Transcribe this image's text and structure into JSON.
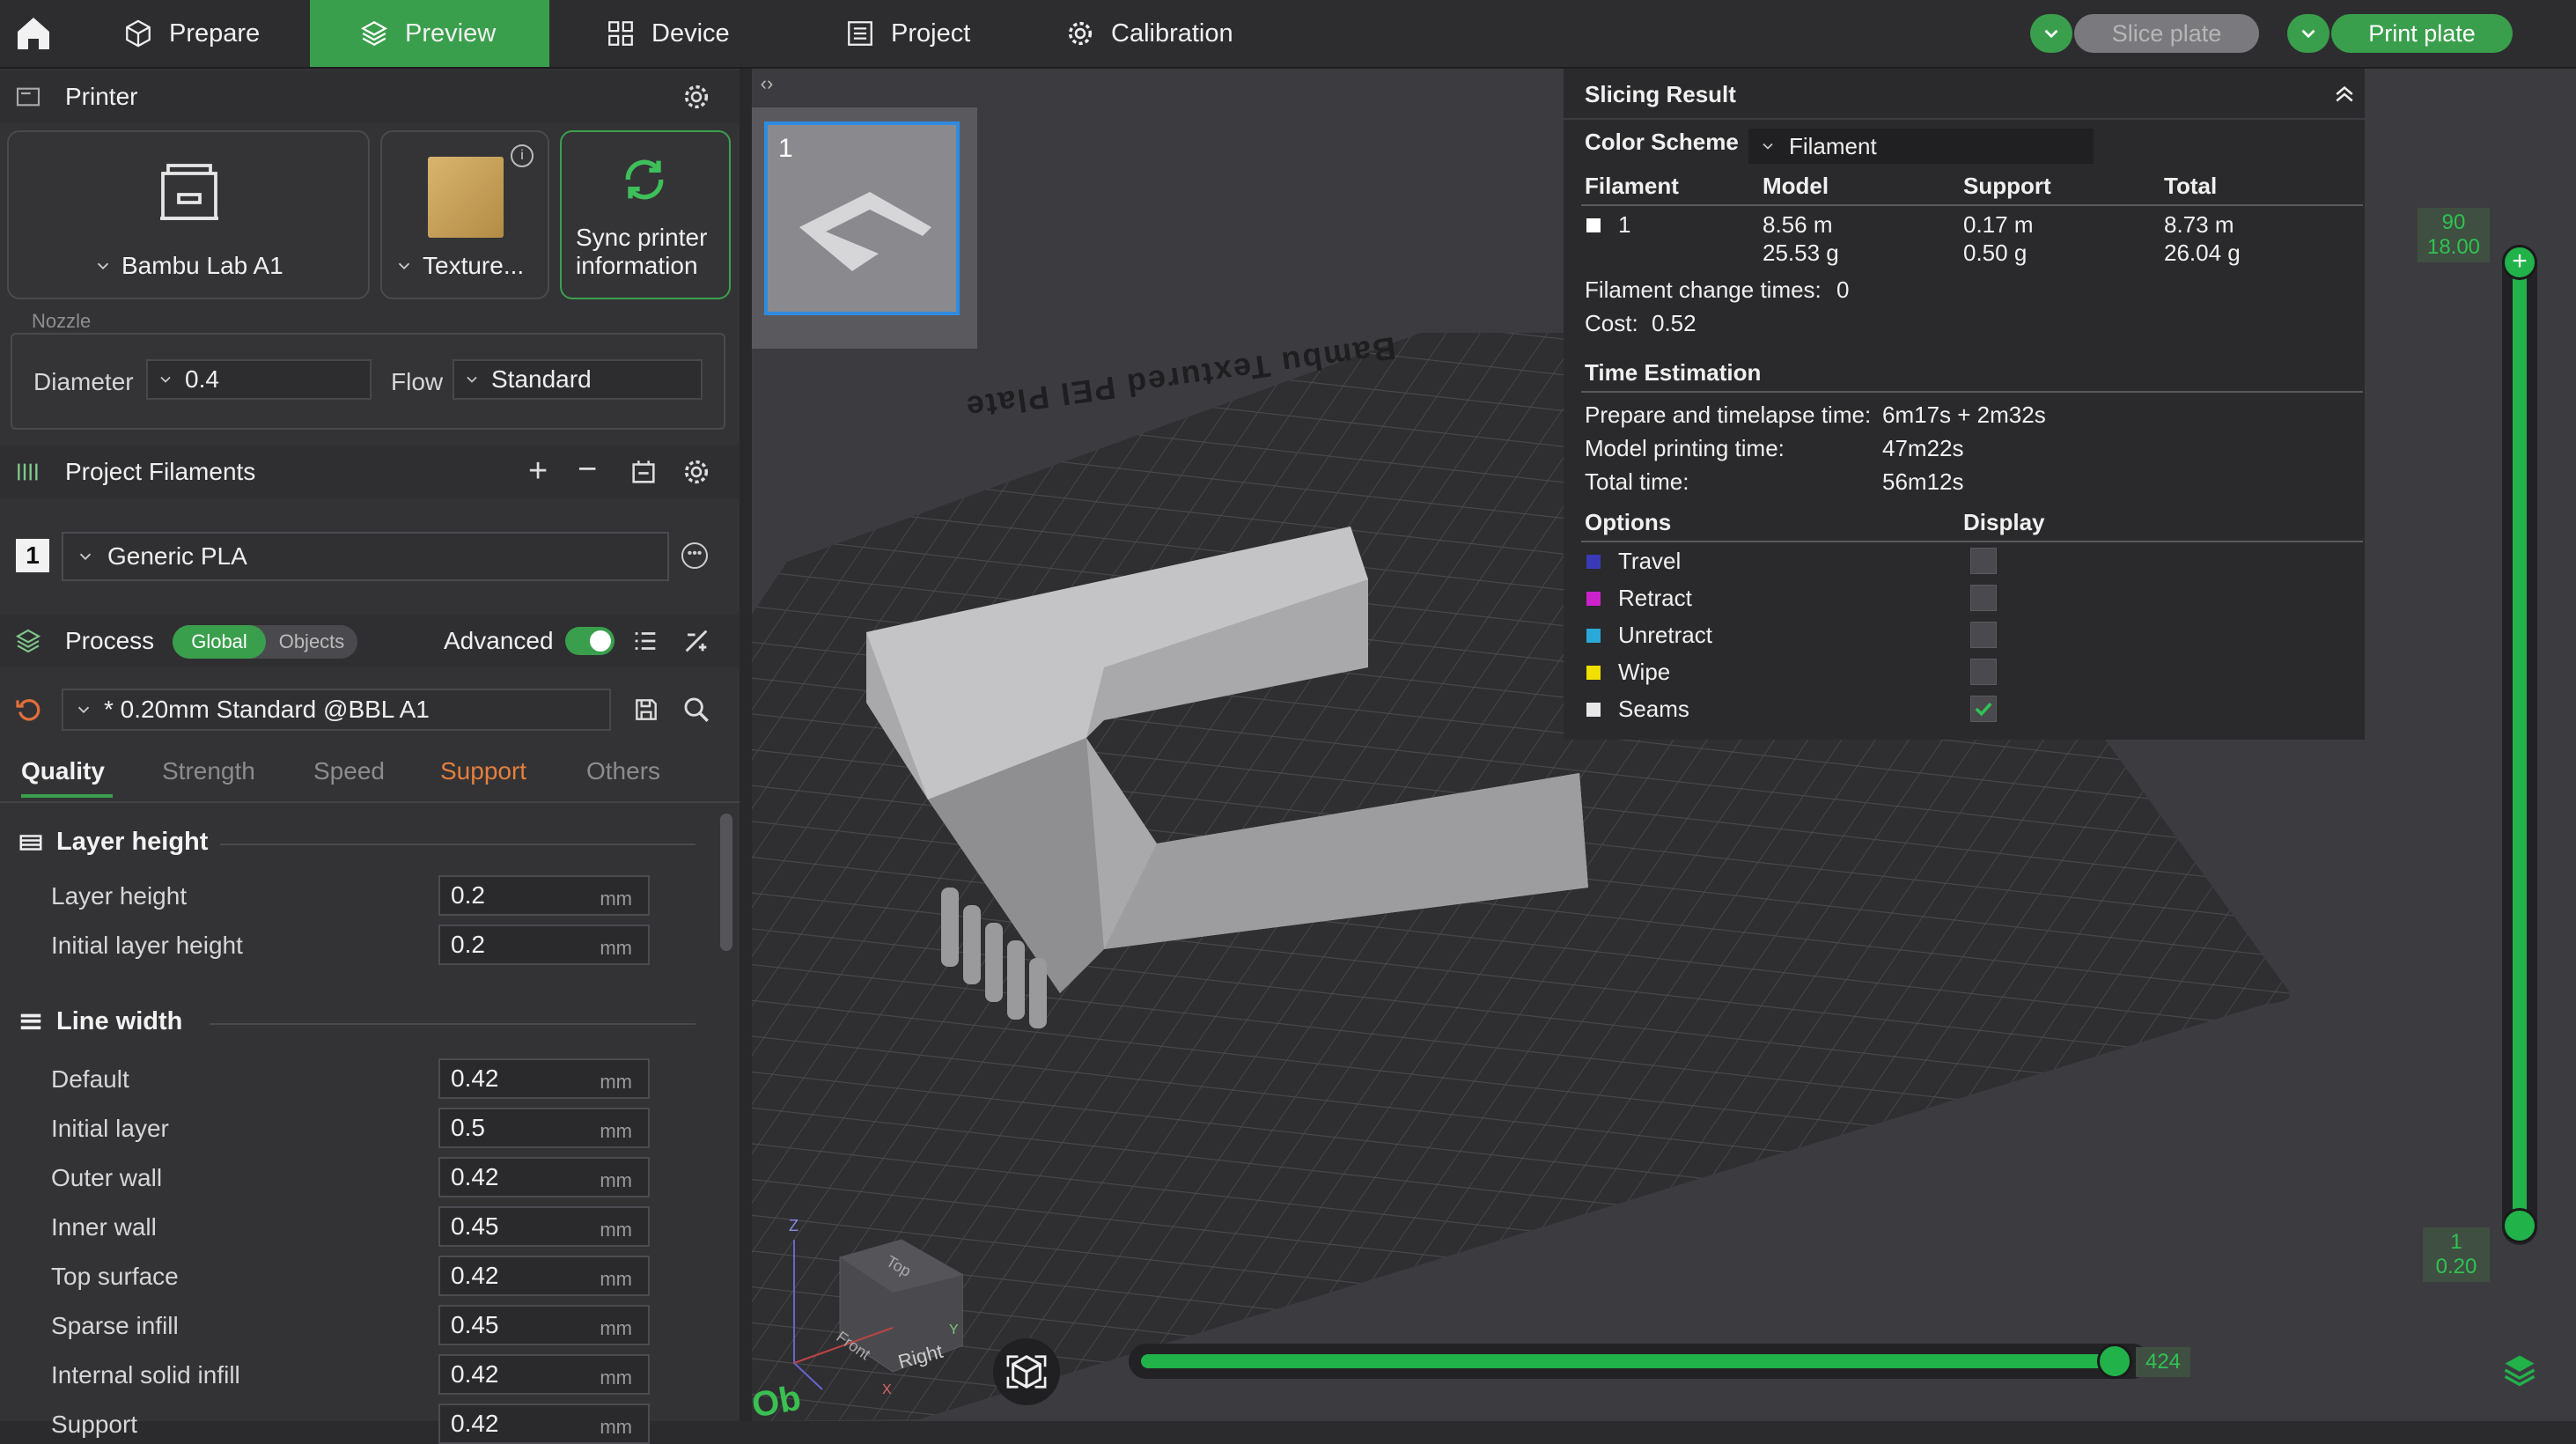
{
  "topbar": {
    "tabs": [
      {
        "label": "Prepare",
        "icon": "cube-icon"
      },
      {
        "label": "Preview",
        "icon": "layers-icon"
      },
      {
        "label": "Device",
        "icon": "device-icon"
      },
      {
        "label": "Project",
        "icon": "list-icon"
      },
      {
        "label": "Calibration",
        "icon": "gear-icon"
      }
    ],
    "slice_label": "Slice plate",
    "print_label": "Print plate",
    "accent": "#3a9f4c"
  },
  "printer": {
    "title": "Printer",
    "printer_name": "Bambu Lab A1",
    "plate_name": "Texture...",
    "sync_label": "Sync printer information",
    "nozzle_title": "Nozzle",
    "diameter_label": "Diameter",
    "diameter_value": "0.4",
    "flow_label": "Flow",
    "flow_value": "Standard"
  },
  "filaments": {
    "title": "Project Filaments",
    "items": [
      {
        "index": "1",
        "name": "Generic PLA"
      }
    ]
  },
  "process": {
    "title": "Process",
    "global_label": "Global",
    "objects_label": "Objects",
    "advanced_label": "Advanced",
    "preset": "* 0.20mm Standard @BBL A1",
    "tabs": [
      "Quality",
      "Strength",
      "Speed",
      "Support",
      "Others"
    ],
    "sections": [
      {
        "title": "Layer height",
        "rows": [
          {
            "label": "Layer height",
            "value": "0.2",
            "unit": "mm"
          },
          {
            "label": "Initial layer height",
            "value": "0.2",
            "unit": "mm"
          }
        ]
      },
      {
        "title": "Line width",
        "rows": [
          {
            "label": "Default",
            "value": "0.42",
            "unit": "mm"
          },
          {
            "label": "Initial layer",
            "value": "0.5",
            "unit": "mm"
          },
          {
            "label": "Outer wall",
            "value": "0.42",
            "unit": "mm"
          },
          {
            "label": "Inner wall",
            "value": "0.45",
            "unit": "mm"
          },
          {
            "label": "Top surface",
            "value": "0.42",
            "unit": "mm"
          },
          {
            "label": "Sparse infill",
            "value": "0.45",
            "unit": "mm"
          },
          {
            "label": "Internal solid infill",
            "value": "0.42",
            "unit": "mm"
          },
          {
            "label": "Support",
            "value": "0.42",
            "unit": "mm"
          }
        ]
      }
    ]
  },
  "viewport": {
    "plate_number": "1",
    "bed_label": "Bambu Textured PEI Plate",
    "cube_top": "Top",
    "cube_front": "Front",
    "cube_right": "Right",
    "axis_z": "Z",
    "axis_x": "X",
    "axis_y": "Y",
    "layer_top_index": "90",
    "layer_top_height": "18.00",
    "layer_bottom_index": "1",
    "layer_bottom_height": "0.20",
    "move_value": "424",
    "move_fraction": 1.0
  },
  "slicing_result": {
    "title": "Slicing Result",
    "color_scheme_label": "Color Scheme",
    "color_scheme_value": "Filament",
    "headers": [
      "Filament",
      "Model",
      "Support",
      "Total"
    ],
    "row": {
      "filament": "1",
      "model_len": "8.56 m",
      "model_weight": "25.53 g",
      "support_len": "0.17 m",
      "support_weight": "0.50 g",
      "total_len": "8.73 m",
      "total_weight": "26.04 g"
    },
    "change_times_label": "Filament change times:",
    "change_times_value": "0",
    "cost_label": "Cost:",
    "cost_value": "0.52",
    "time_title": "Time Estimation",
    "prepare_label": "Prepare and timelapse time:",
    "prepare_value": "6m17s + 2m32s",
    "model_time_label": "Model printing time:",
    "model_time_value": "47m22s",
    "total_time_label": "Total time:",
    "total_time_value": "56m12s",
    "options_label": "Options",
    "display_label": "Display",
    "options": [
      {
        "label": "Travel",
        "color": "#3a3ab8",
        "checked": false
      },
      {
        "label": "Retract",
        "color": "#cc22cc",
        "checked": false
      },
      {
        "label": "Unretract",
        "color": "#2aa8d8",
        "checked": false
      },
      {
        "label": "Wipe",
        "color": "#f0e000",
        "checked": false
      },
      {
        "label": "Seams",
        "color": "#e8e8e8",
        "checked": true
      }
    ]
  }
}
